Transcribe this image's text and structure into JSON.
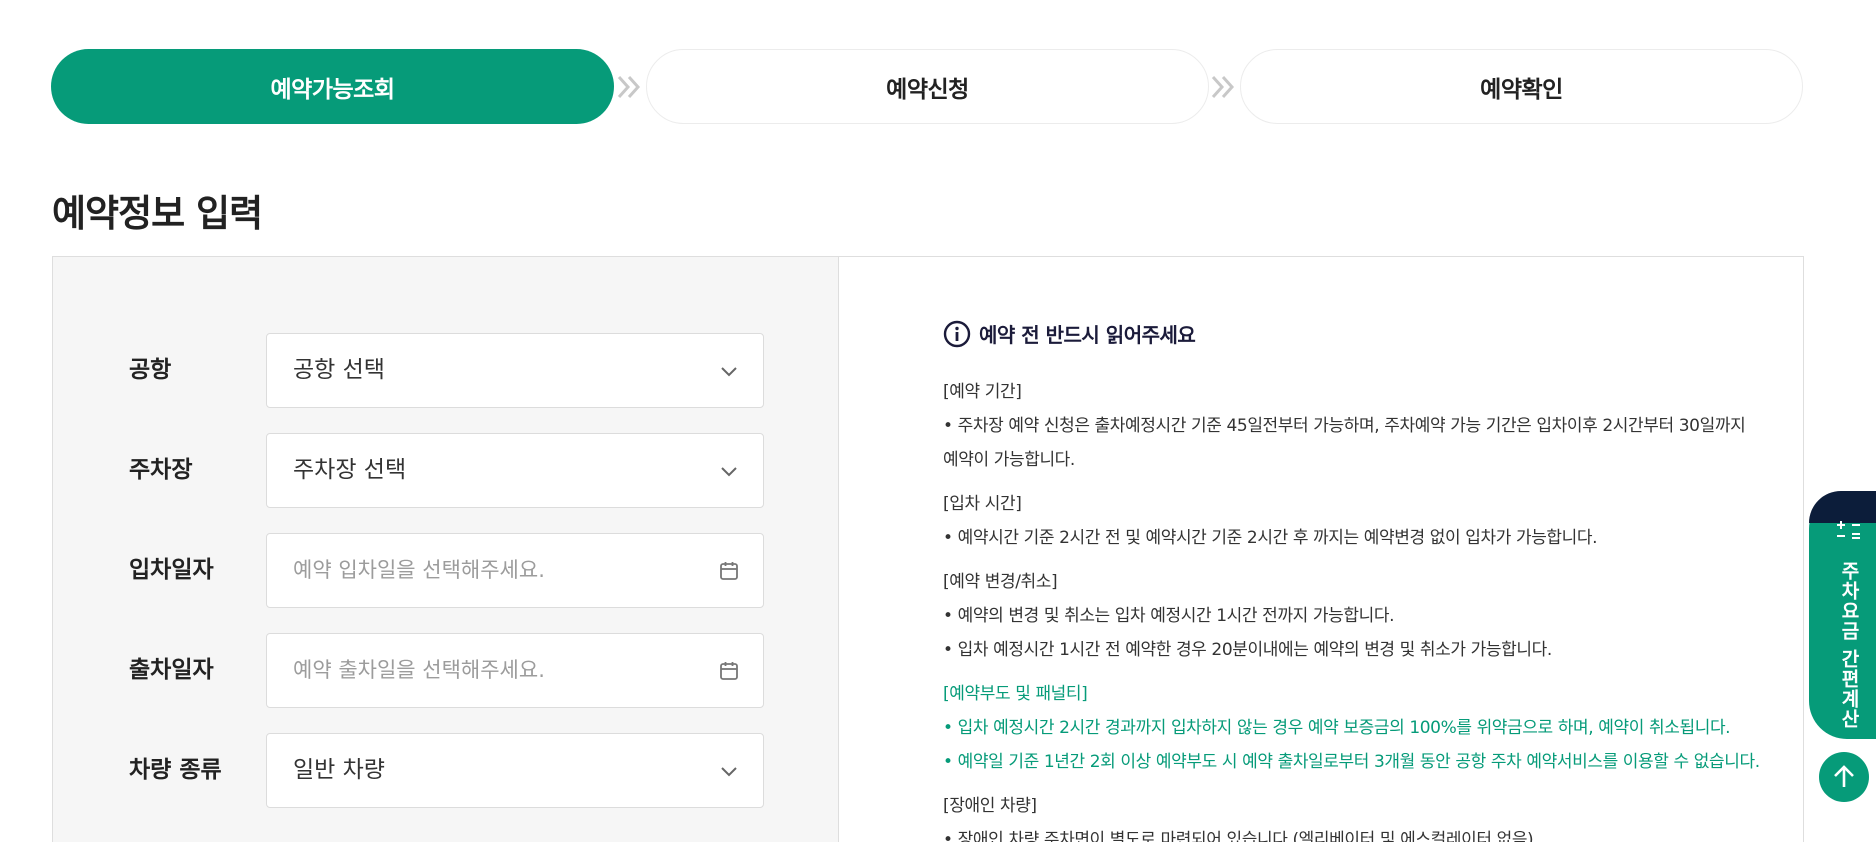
{
  "steps": [
    {
      "label": "예약가능조회",
      "active": true
    },
    {
      "label": "예약신청",
      "active": false
    },
    {
      "label": "예약확인",
      "active": false
    }
  ],
  "section_title": "예약정보 입력",
  "form": {
    "airport": {
      "label": "공항",
      "value": "공항 선택"
    },
    "parking": {
      "label": "주차장",
      "value": "주차장 선택"
    },
    "entry_date": {
      "label": "입차일자",
      "placeholder": "예약 입차일을 선택해주세요."
    },
    "exit_date": {
      "label": "출차일자",
      "placeholder": "예약 출차일을 선택해주세요."
    },
    "vehicle_type": {
      "label": "차량 종류",
      "value": "일반 차량"
    }
  },
  "notice": {
    "title": "예약 전 반드시 읽어주세요",
    "sections": [
      {
        "title": "[예약 기간]",
        "lines": [
          "• 주차장 예약 신청은 출차예정시간 기준 45일전부터 가능하며, 주차예약 가능 기간은 입차이후 2시간부터 30일까지",
          "예약이 가능합니다."
        ]
      },
      {
        "title": "[입차 시간]",
        "lines": [
          "• 예약시간 기준 2시간 전 및 예약시간 기준 2시간 후 까지는 예약변경 없이 입차가 가능합니다."
        ]
      },
      {
        "title": "[예약 변경/취소]",
        "lines": [
          "• 예약의 변경 및 취소는 입차 예정시간 1시간 전까지 가능합니다.",
          "• 입차 예정시간 1시간 전 예약한 경우 20분이내에는 예약의 변경 및 취소가 가능합니다."
        ]
      },
      {
        "title": "[예약부도 및 패널티]",
        "lines": [
          "• 입차 예정시간 2시간 경과까지 입차하지 않는 경우 예약 보증금의 100%를 위약금으로 하며, 예약이 취소됩니다.",
          "• 예약일 기준 1년간 2회 이상 예약부도 시 예약 출차일로부터 3개월 동안 공항 주차 예약서비스를 이용할 수 없습니다."
        ]
      },
      {
        "title": "[장애인 차량]",
        "lines": [
          "• 장애인 차량 주차면이 별도로 마련되어 있습니다.(엘리베이터 및 에스컬레이터 없음)"
        ]
      }
    ]
  },
  "floating": {
    "calc_label": "주차요금 간편계산",
    "top_icon": "arrow-up-icon"
  },
  "colors": {
    "accent": "#069b79",
    "dark": "#0c1d3a"
  }
}
